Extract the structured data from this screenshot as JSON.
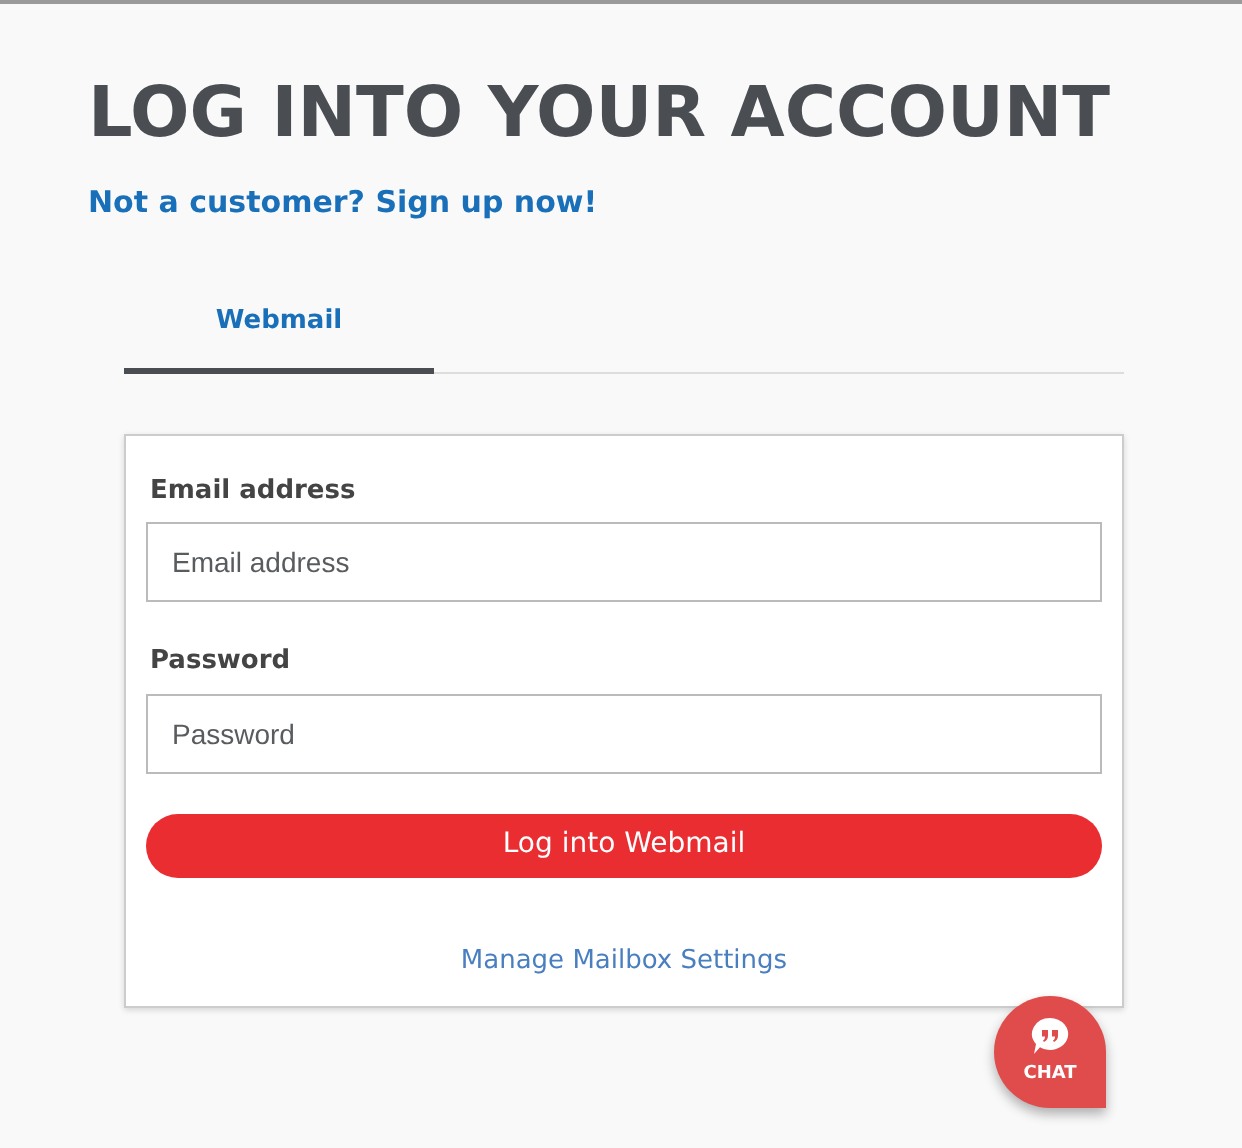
{
  "heading": "LOG INTO YOUR ACCOUNT",
  "signup_link": "Not a customer? Sign up now!",
  "tabs": [
    {
      "label": "Webmail",
      "selected": true
    }
  ],
  "fields": [
    {
      "label": "Email address",
      "placeholder": "Email address"
    },
    {
      "label": "Password",
      "placeholder": "Password"
    }
  ],
  "submit_button": "Log into Webmail",
  "settings_link": "Manage Mailbox Settings",
  "chat_button": "CHAT"
}
